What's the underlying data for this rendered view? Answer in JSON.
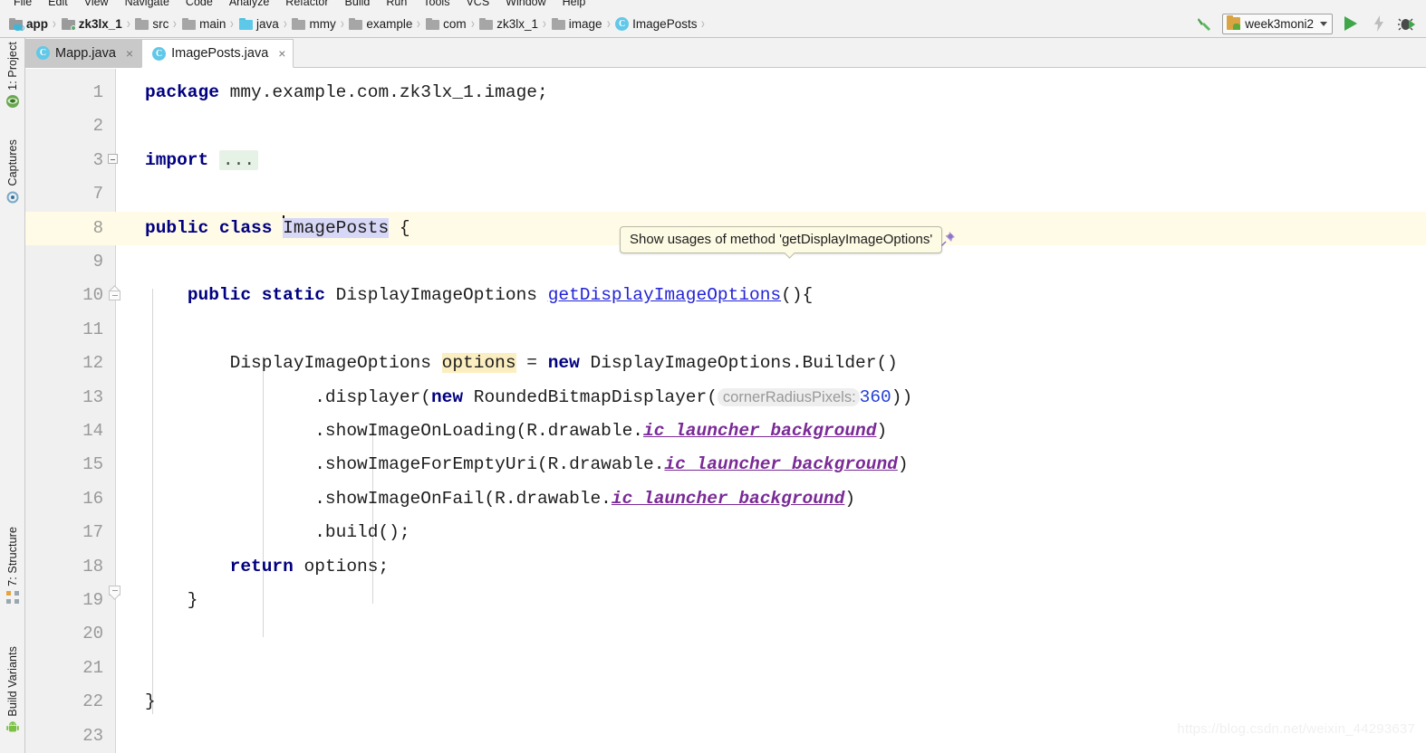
{
  "menu": {
    "items": [
      "File",
      "Edit",
      "View",
      "Navigate",
      "Code",
      "Analyze",
      "Refactor",
      "Build",
      "Run",
      "Tools",
      "VCS",
      "Window",
      "Help"
    ]
  },
  "breadcrumb": {
    "items": [
      {
        "label": "app",
        "icon": "module-folder-icon",
        "bold": true
      },
      {
        "label": "zk3lx_1",
        "icon": "module-folder-icon",
        "bold": true
      },
      {
        "label": "src",
        "icon": "folder-icon",
        "bold": false
      },
      {
        "label": "main",
        "icon": "folder-icon",
        "bold": false
      },
      {
        "label": "java",
        "icon": "java-source-folder-icon",
        "bold": false
      },
      {
        "label": "mmy",
        "icon": "package-folder-icon",
        "bold": false
      },
      {
        "label": "example",
        "icon": "package-folder-icon",
        "bold": false
      },
      {
        "label": "com",
        "icon": "package-folder-icon",
        "bold": false
      },
      {
        "label": "zk3lx_1",
        "icon": "package-folder-icon",
        "bold": false
      },
      {
        "label": "image",
        "icon": "package-folder-icon",
        "bold": false
      },
      {
        "label": "ImagePosts",
        "icon": "java-class-icon",
        "bold": false
      }
    ],
    "separator": "›"
  },
  "run_controls": {
    "build_icon": "hammer-icon",
    "config_name": "week3moni2",
    "config_icon": "android-run-config-icon",
    "run_icon": "run-play-icon",
    "apply_changes_icon": "apply-changes-bolt-icon",
    "debug_icon": "debug-bug-icon"
  },
  "editor_tabs": [
    {
      "label": "Mapp.java",
      "icon": "java-class-icon",
      "active": false,
      "close": "×"
    },
    {
      "label": "ImagePosts.java",
      "icon": "java-class-icon",
      "active": true,
      "close": "×"
    }
  ],
  "left_tool_window": {
    "items": [
      {
        "label": "1: Project",
        "icon": "project-icon",
        "underline_index": 0
      },
      {
        "label": "Captures",
        "icon": "captures-icon",
        "underline_index": -1
      },
      {
        "label": "7: Structure",
        "icon": "structure-icon",
        "underline_index": 0
      },
      {
        "label": "Build Variants",
        "icon": "android-robot-icon",
        "underline_index": -1
      }
    ]
  },
  "tooltip": {
    "text": "Show usages of method 'getDisplayImageOptions'",
    "pin_icon": "pin-icon"
  },
  "watermark": {
    "text": "https://blog.csdn.net/weixin_44293637"
  },
  "code": {
    "file": "ImagePosts.java",
    "line_numbers": [
      "1",
      "2",
      "3",
      "7",
      "8",
      "9",
      "10",
      "11",
      "12",
      "13",
      "14",
      "15",
      "16",
      "17",
      "18",
      "19",
      "20",
      "21",
      "22",
      "23"
    ],
    "caret_line": "8",
    "selection_text": "ImagePosts",
    "highlighted_identifier": "options",
    "folded_placeholder": "...",
    "lines": [
      {
        "n": "1",
        "text": "package mmy.example.com.zk3lx_1.image;"
      },
      {
        "n": "2",
        "text": ""
      },
      {
        "n": "3",
        "text": "import ..."
      },
      {
        "n": "7",
        "text": ""
      },
      {
        "n": "8",
        "text": "public class ImagePosts {"
      },
      {
        "n": "9",
        "text": ""
      },
      {
        "n": "10",
        "text": "    public static DisplayImageOptions getDisplayImageOptions(){"
      },
      {
        "n": "11",
        "text": ""
      },
      {
        "n": "12",
        "text": "        DisplayImageOptions options = new DisplayImageOptions.Builder()"
      },
      {
        "n": "13",
        "text": "                .displayer(new RoundedBitmapDisplayer( cornerRadiusPixels: 360))"
      },
      {
        "n": "14",
        "text": "                .showImageOnLoading(R.drawable.ic_launcher_background)"
      },
      {
        "n": "15",
        "text": "                .showImageForEmptyUri(R.drawable.ic_launcher_background)"
      },
      {
        "n": "16",
        "text": "                .showImageOnFail(R.drawable.ic_launcher_background)"
      },
      {
        "n": "17",
        "text": "                .build();"
      },
      {
        "n": "18",
        "text": "        return options;"
      },
      {
        "n": "19",
        "text": "    }"
      },
      {
        "n": "20",
        "text": ""
      },
      {
        "n": "21",
        "text": ""
      },
      {
        "n": "22",
        "text": "}"
      },
      {
        "n": "23",
        "text": ""
      }
    ],
    "inlay_hint": {
      "param": "cornerRadiusPixels:",
      "value": "360"
    },
    "method_name": "getDisplayImageOptions",
    "static_field": "ic_launcher_background"
  },
  "colors": {
    "keyword": "#000080",
    "number": "#2540d8",
    "static_field": "#7a2a96",
    "method_link": "#2323d8",
    "selection": "#d7d7f7",
    "identifier_highlight": "#fbeec0",
    "caret_line": "#fffbe6",
    "fold_placeholder_bg": "#e6f2e6",
    "accent_green": "#3fa64a",
    "tab_active_bg": "#ffffff",
    "tab_inactive_bg": "#c9c9c9",
    "chrome_bg": "#f2f2f2"
  }
}
